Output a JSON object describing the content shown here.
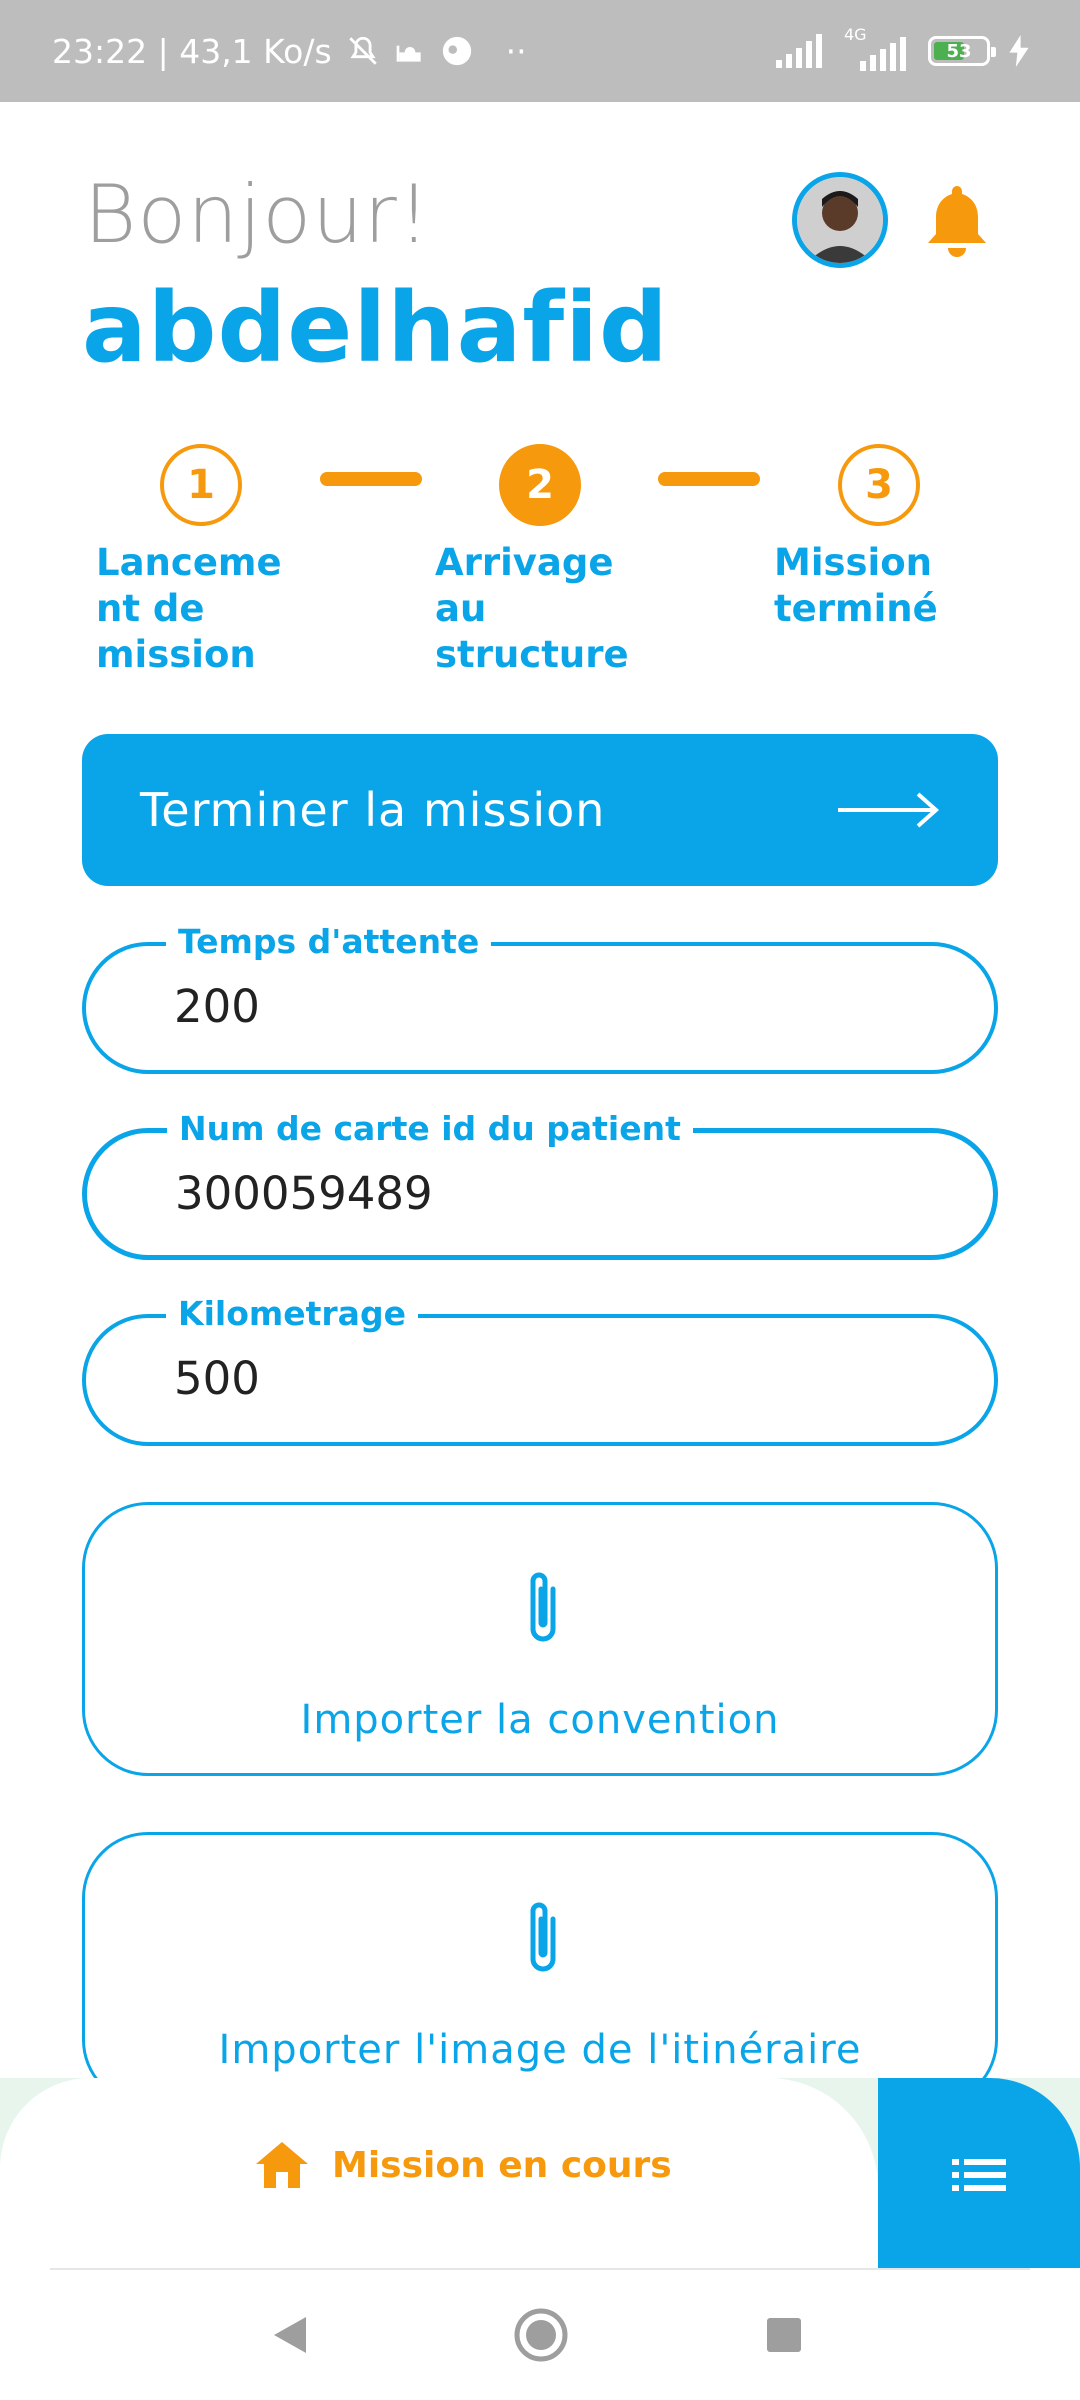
{
  "status_bar": {
    "time_speed": "23:22 | 43,1 Ko/s",
    "dots": "··",
    "network_label": "4G",
    "battery": "53"
  },
  "header": {
    "greeting": "Bonjour!",
    "username": "abdelhafid"
  },
  "stepper": {
    "steps": [
      {
        "number": "1",
        "label": "Lanceme\nnt de\nmission"
      },
      {
        "number": "2",
        "label": "Arrivage\nau\nstructure"
      },
      {
        "number": "3",
        "label": "Mission\nterminé"
      }
    ]
  },
  "primary_button": {
    "label": "Terminer la mission"
  },
  "fields": [
    {
      "label": "Temps d'attente",
      "value": "200"
    },
    {
      "label": "Num de carte id du patient",
      "value": "300059489"
    },
    {
      "label": "Kilometrage",
      "value": "500"
    }
  ],
  "uploads": [
    {
      "label": "Importer la convention"
    },
    {
      "label": "Importer l'image de l'itinéraire"
    }
  ],
  "bottom_nav": {
    "active_label": "Mission en cours"
  },
  "colors": {
    "accent": "#0aa5e8",
    "orange": "#f7990d"
  }
}
